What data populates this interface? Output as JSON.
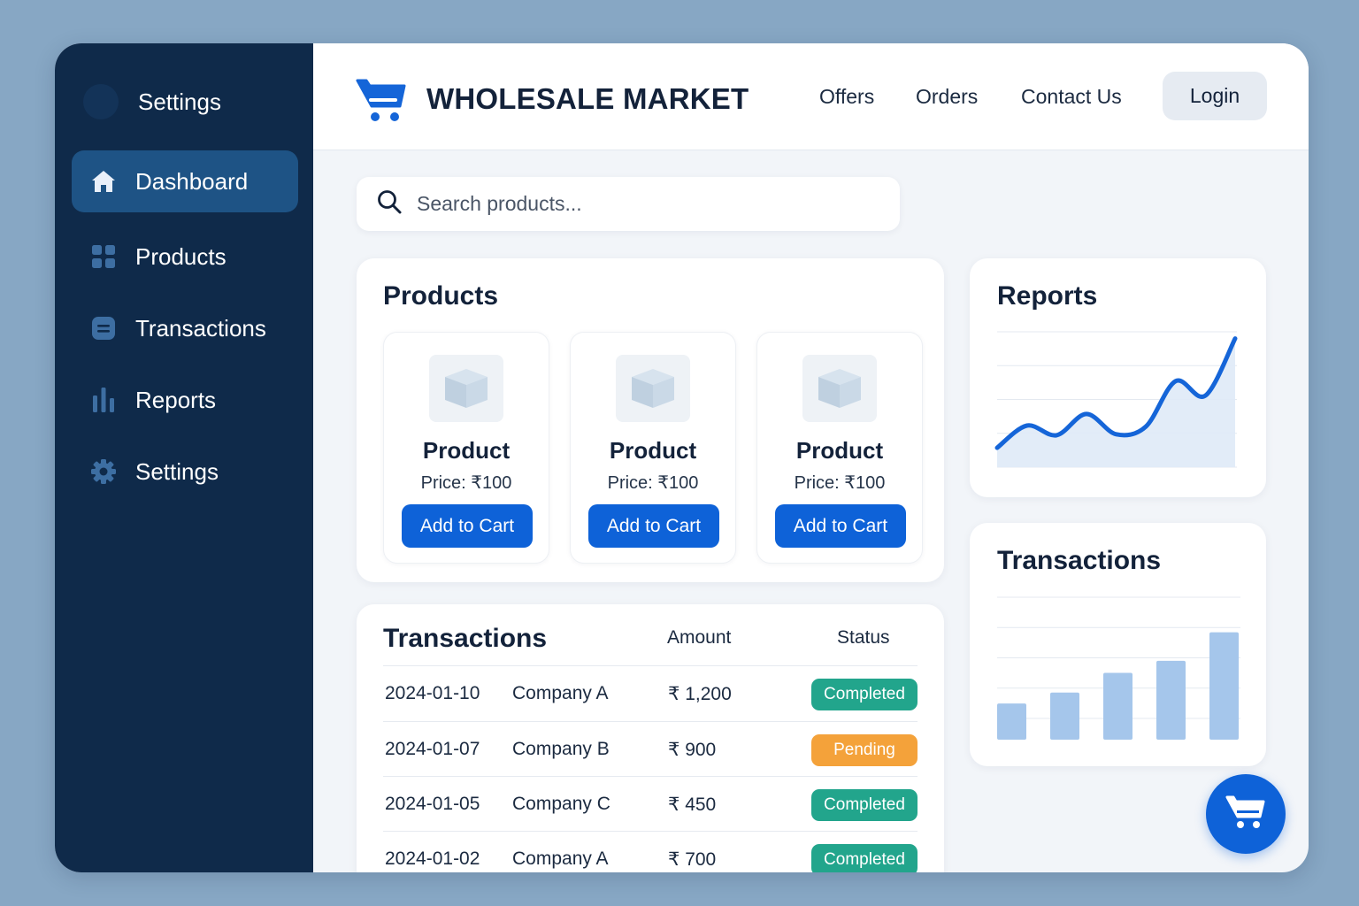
{
  "sidebar": {
    "header_label": "Settings",
    "items": [
      {
        "label": "Dashboard",
        "icon": "home-icon",
        "active": true
      },
      {
        "label": "Products",
        "icon": "grid-icon",
        "active": false
      },
      {
        "label": "Transactions",
        "icon": "list-icon",
        "active": false
      },
      {
        "label": "Reports",
        "icon": "bar-chart-icon",
        "active": false
      },
      {
        "label": "Settings",
        "icon": "gear-icon",
        "active": false
      }
    ]
  },
  "header": {
    "brand": "WHOLESALE MARKET",
    "nav": [
      "Offers",
      "Orders",
      "Contact Us"
    ],
    "login_label": "Login"
  },
  "search": {
    "placeholder": "Search products..."
  },
  "products": {
    "title": "Products",
    "items": [
      {
        "name": "Product",
        "price": "Price: ₹100",
        "button": "Add to Cart"
      },
      {
        "name": "Product",
        "price": "Price: ₹100",
        "button": "Add to Cart"
      },
      {
        "name": "Product",
        "price": "Price: ₹100",
        "button": "Add to Cart"
      }
    ]
  },
  "transactions": {
    "title": "Transactions",
    "col_amount": "Amount",
    "col_status": "Status",
    "rows": [
      {
        "date": "2024-01-10",
        "company": "Company A",
        "amount": "₹ 1,200",
        "status": "Completed"
      },
      {
        "date": "2024-01-07",
        "company": "Company B",
        "amount": "₹ 900",
        "status": "Pending"
      },
      {
        "date": "2024-01-05",
        "company": "Company C",
        "amount": "₹ 450",
        "status": "Completed"
      },
      {
        "date": "2024-01-02",
        "company": "Company A",
        "amount": "₹ 700",
        "status": "Completed"
      }
    ]
  },
  "status_colors": {
    "Completed": "#22a58c",
    "Pending": "#f4a23a"
  },
  "reports_card": {
    "title": "Reports",
    "chart_data": {
      "type": "area",
      "values": [
        2,
        4.3,
        3.3,
        5.5,
        3.4,
        4.2,
        8.9,
        7.4,
        13.3
      ],
      "ylim": [
        0,
        14
      ],
      "grid": true
    }
  },
  "transactions_card": {
    "title": "Transactions",
    "chart_data": {
      "type": "bar",
      "values": [
        3.3,
        4.3,
        6.1,
        7.2,
        9.8
      ],
      "ylim": [
        0,
        13
      ],
      "grid": true
    }
  },
  "colors": {
    "accent": "#0e62d8",
    "sidebar": "#0f2a4a",
    "sidebar_active": "#1e5385"
  }
}
